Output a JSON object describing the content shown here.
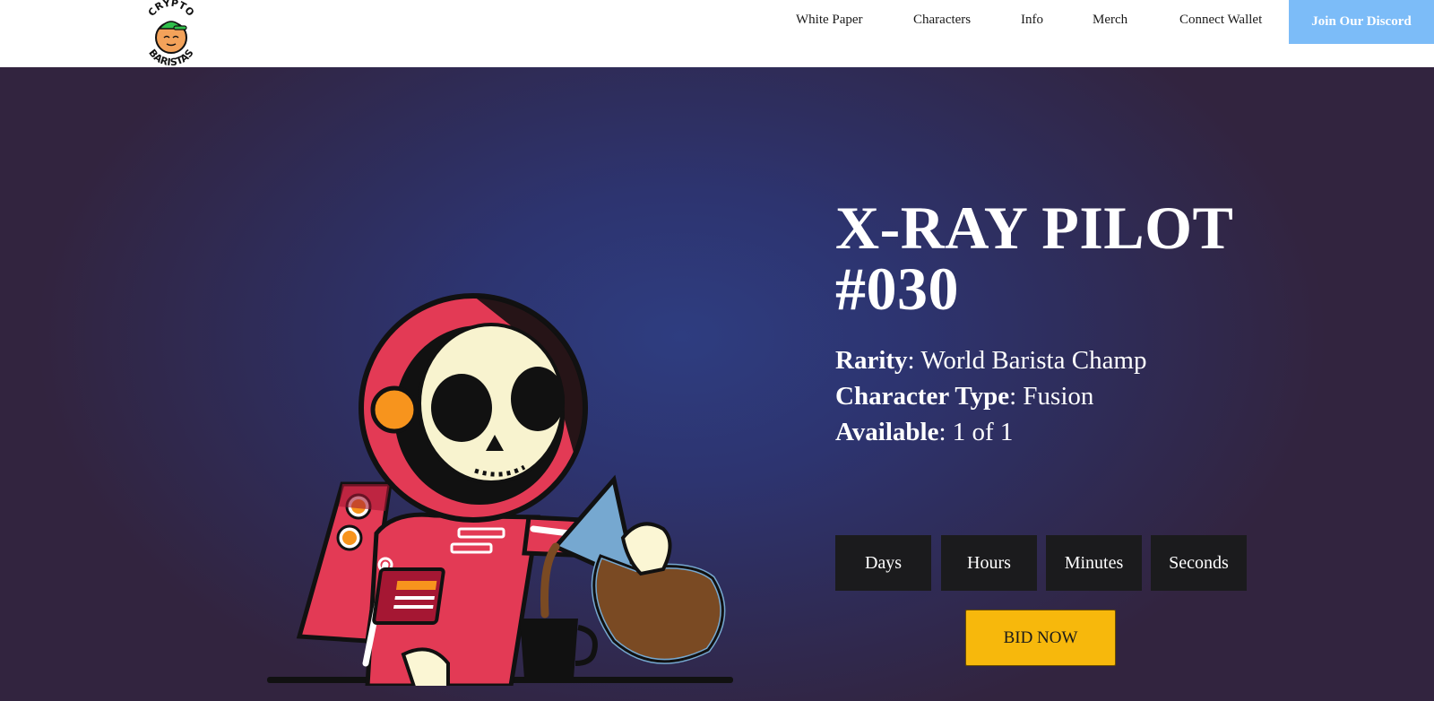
{
  "logo": {
    "top_text": "CRYPTO",
    "bottom_text": "BARISTAS"
  },
  "nav": {
    "links": [
      "White Paper",
      "Characters",
      "Info",
      "Merch",
      "Connect Wallet"
    ],
    "discord_label": "Join Our Discord"
  },
  "hero": {
    "title_line1": "X-RAY PILOT",
    "title_line2": "#030",
    "rarity_label": "Rarity",
    "rarity_value": ": World Barista Champ",
    "type_label": "Character Type",
    "type_value": ": Fusion",
    "available_label": "Available",
    "available_value": ": 1 of 1",
    "countdown": [
      "Days",
      "Hours",
      "Minutes",
      "Seconds"
    ],
    "bid_label": "BID NOW"
  },
  "colors": {
    "accent_discord": "#7cbcf8",
    "bid_button": "#f7b80c",
    "countdown_box": "#1b1b1d",
    "hero_background": "#2e3570"
  }
}
